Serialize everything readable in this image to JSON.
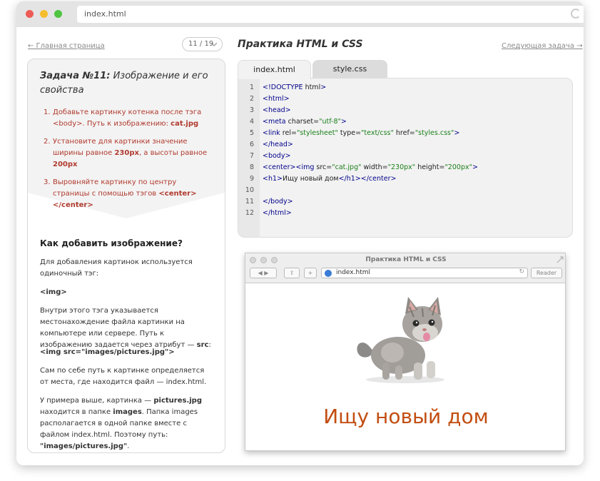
{
  "window": {
    "url": "index.html",
    "dots": [
      "#ee5b55",
      "#f6be2f",
      "#4fc441"
    ]
  },
  "nav": {
    "back": "← Главная страница",
    "counter": "11 / 19",
    "counter_chevron": "chevron-down-icon",
    "next": "Следующая задача →",
    "title": "Практика HTML и CSS"
  },
  "task": {
    "title_bold": "Задача №11:",
    "title_rest": " Изображение и его свойства",
    "steps": [
      {
        "num": "1.",
        "text": "Добавьте картинку котенка после тэга <body>. Путь к изображению: ",
        "bold": "cat.jpg"
      },
      {
        "num": "2.",
        "text": "Установите для картинки значение ширины равное ",
        "bold": "230px",
        "text2": ", а высоты равное ",
        "bold2": "200px"
      },
      {
        "num": "3.",
        "text": "Выровняйте картинку по центру страницы с помощью тэгов ",
        "bold": "<center></center>"
      }
    ]
  },
  "help": {
    "heading": "Как добавить изображение?",
    "p1": "Для добавления картинок используется одиночный тэг:",
    "tag": "<img>",
    "p2": "Внутри этого тэга указывается местонахождение файла картинки на компьютере или сервере. Путь к изображению задается через атрибут — ",
    "p2_bold": "src",
    "p2_end": ":",
    "example": "<img src=\"images/pictures.jpg\">",
    "p3": "Сам по себе путь к картинке определяется от места, где находится файл — index.html.",
    "p4a": "У примера выше, картинка — ",
    "p4b": "pictures.jpg",
    "p4c": " находится в папке ",
    "p4d": "images",
    "p4e": ". Папка images располагается в одной папке вместе с файлом index.html. Поэтому путь: ",
    "p4f": "\"images/pictures.jpg\"",
    "p4g": "."
  },
  "tabs": [
    "index.html",
    "style.css"
  ],
  "code": {
    "lines": [
      {
        "n": "1",
        "p": [
          [
            "<!DOCTYPE ",
            ""
          ],
          [
            "html",
            "t"
          ],
          [
            ">",
            ""
          ]
        ]
      },
      {
        "n": "2",
        "p": [
          [
            "<html>",
            ""
          ]
        ]
      },
      {
        "n": "3",
        "p": [
          [
            "<head>",
            ""
          ]
        ]
      },
      {
        "n": "4",
        "p": [
          [
            "<meta ",
            ""
          ],
          [
            "charset=",
            "t"
          ],
          [
            "\"utf-8\"",
            "s"
          ],
          [
            ">",
            ""
          ]
        ]
      },
      {
        "n": "5",
        "p": [
          [
            "<link ",
            ""
          ],
          [
            "rel=",
            "t"
          ],
          [
            "\"stylesheet\"",
            "s"
          ],
          [
            " type=",
            "t"
          ],
          [
            "\"text/css\"",
            "s"
          ],
          [
            " href=",
            "t"
          ],
          [
            "\"styles.css\"",
            "s"
          ],
          [
            ">",
            ""
          ]
        ]
      },
      {
        "n": "6",
        "p": [
          [
            "</head>",
            ""
          ]
        ]
      },
      {
        "n": "7",
        "p": [
          [
            "<body>",
            ""
          ]
        ]
      },
      {
        "n": "8",
        "p": [
          [
            "<center><img ",
            ""
          ],
          [
            "src=",
            "t"
          ],
          [
            "\"cat.jpg\"",
            "s"
          ],
          [
            " width=",
            "t"
          ],
          [
            "\"230px\"",
            "s"
          ],
          [
            " height=",
            "t"
          ],
          [
            "\"200px\"",
            "s"
          ],
          [
            ">",
            ""
          ]
        ]
      },
      {
        "n": "9",
        "p": [
          [
            "<h1>",
            ""
          ],
          [
            "Ищу новый дом",
            "t"
          ],
          [
            "</h1></center>",
            ""
          ]
        ]
      },
      {
        "n": "10",
        "p": []
      },
      {
        "n": "11",
        "p": [
          [
            "</body>",
            ""
          ]
        ]
      },
      {
        "n": "12",
        "p": [
          [
            "</html>",
            ""
          ]
        ]
      }
    ]
  },
  "preview": {
    "window_title": "Практика HTML и CSS",
    "url": "index.html",
    "reader": "Reader",
    "heading": "Ищу новый дом"
  }
}
